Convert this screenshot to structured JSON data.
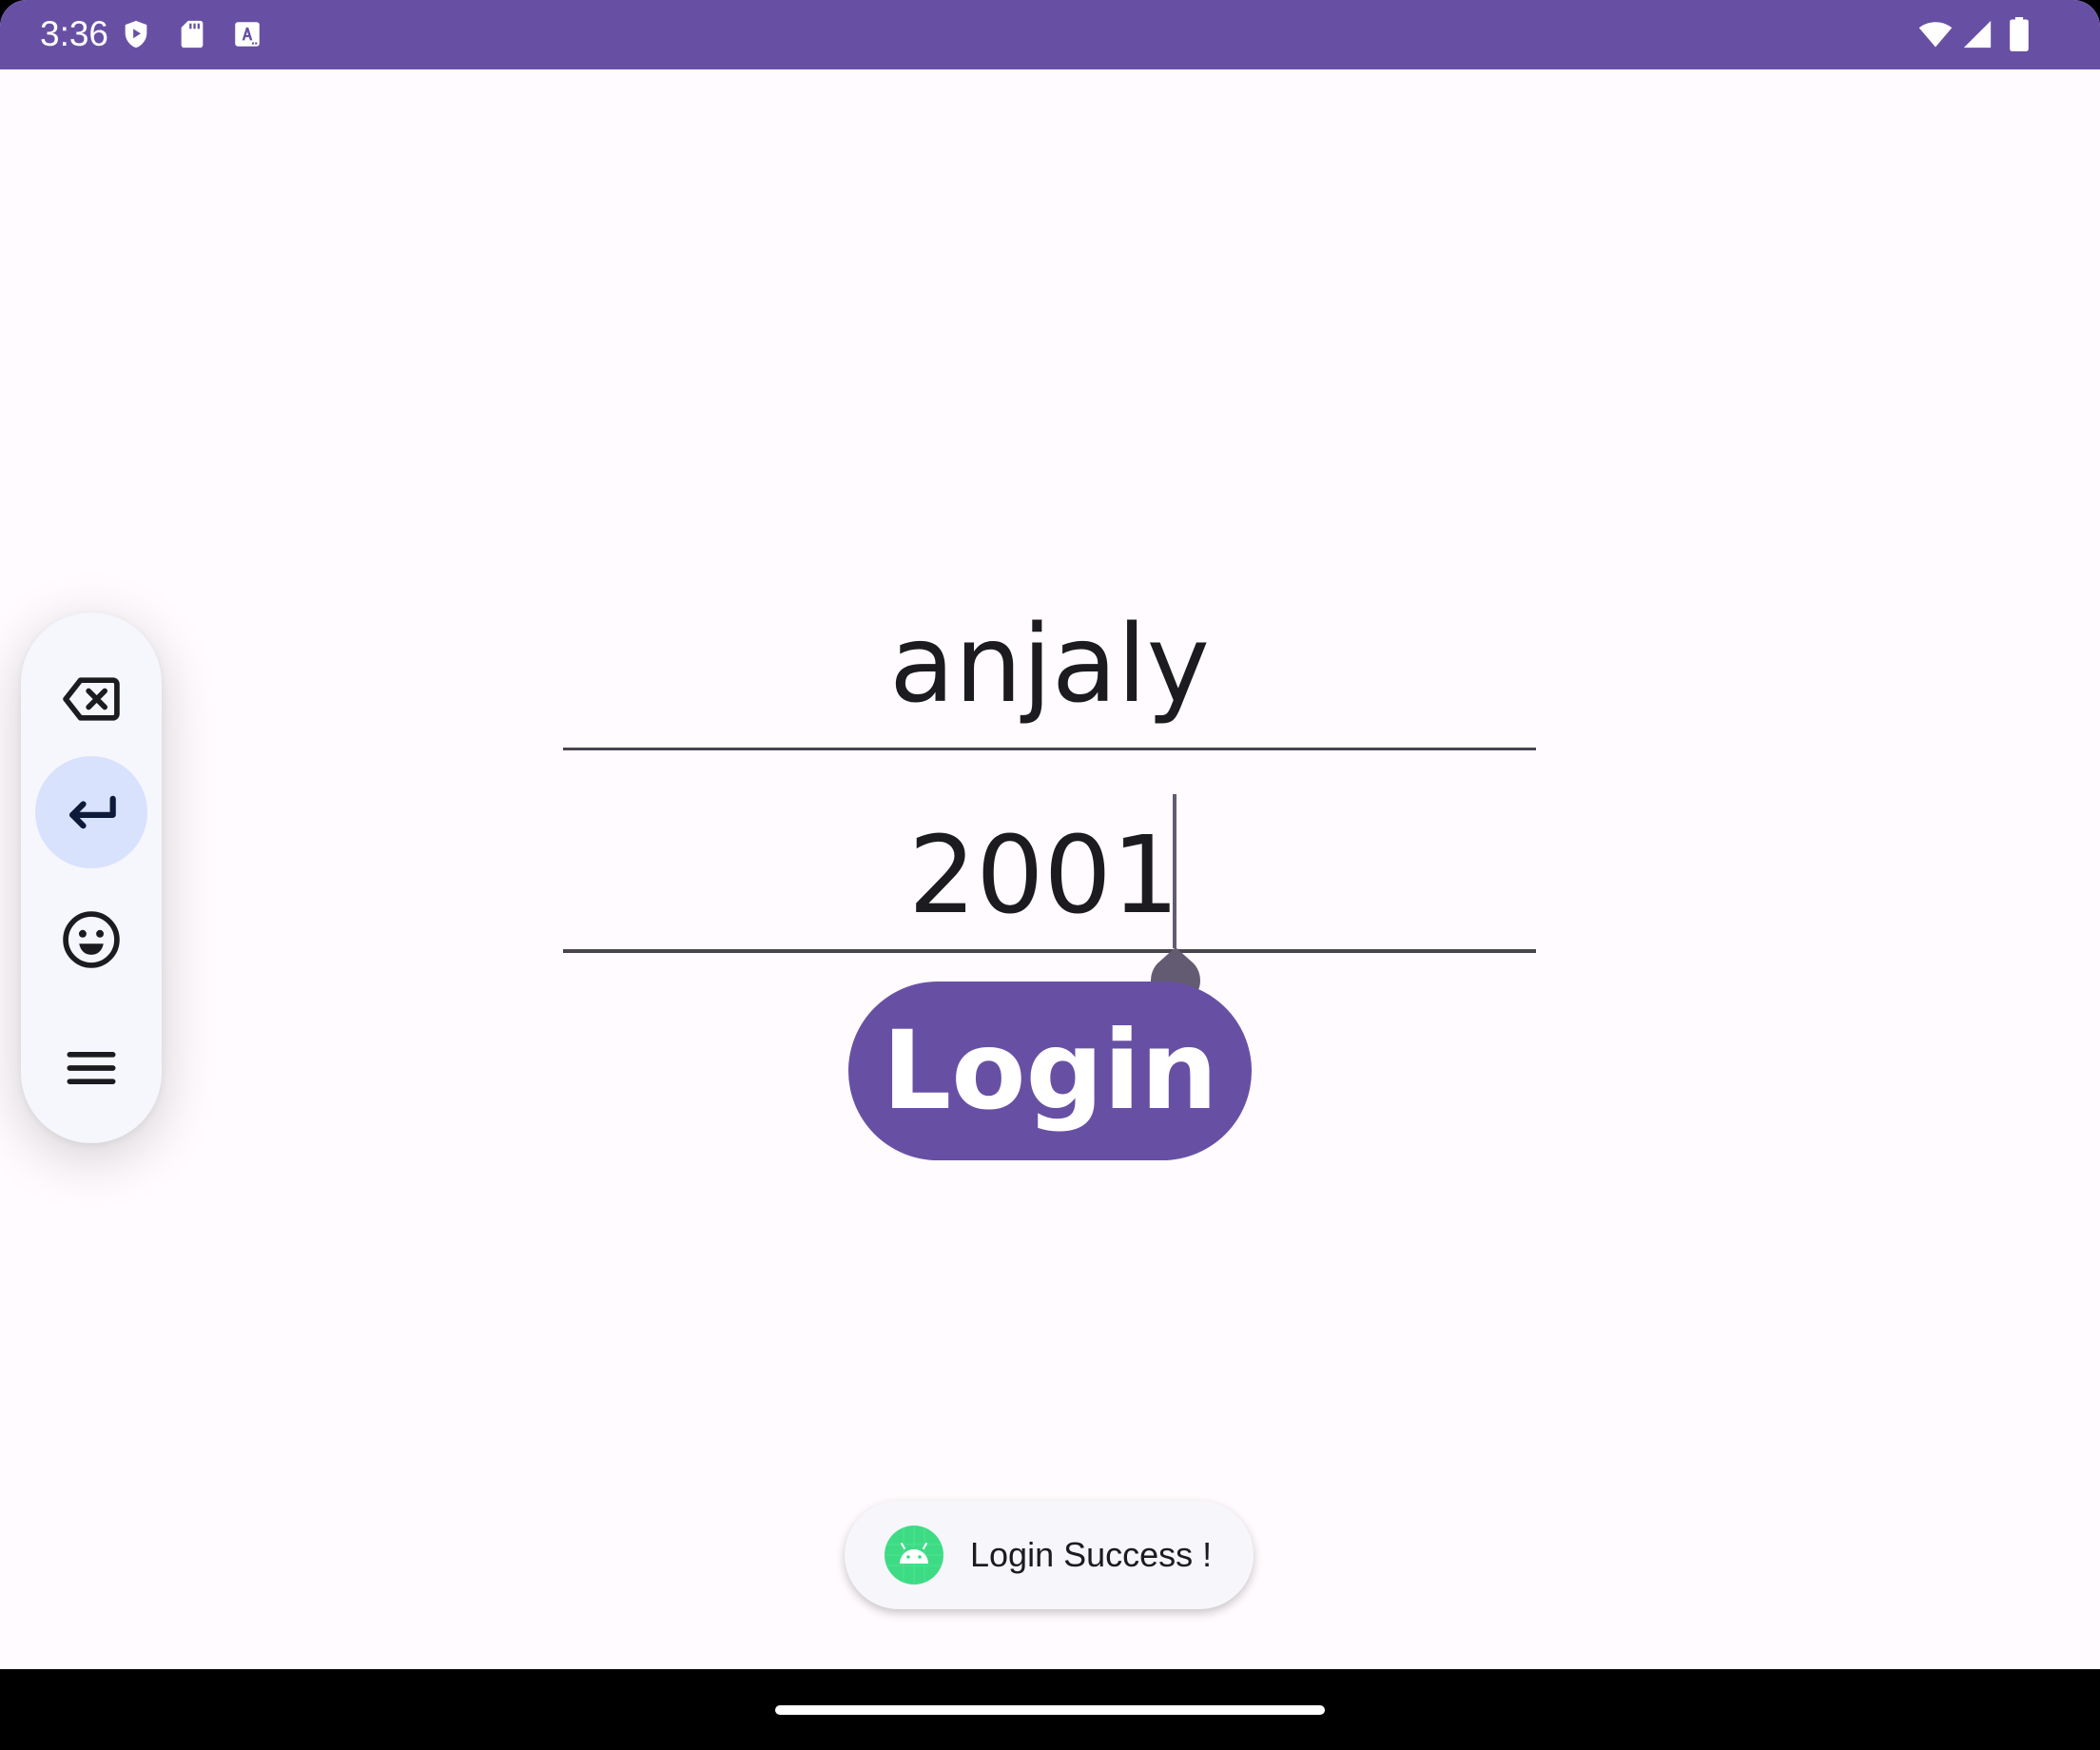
{
  "status_bar": {
    "time": "3:36",
    "left_icons": [
      "play-protect-icon",
      "sd-card-icon",
      "keyboard-a-icon"
    ],
    "right_icons": [
      "wifi-icon",
      "cellular-signal-icon",
      "battery-icon"
    ],
    "color": "#6750a4"
  },
  "login_form": {
    "username_value": "anjaly",
    "password_value": "2001",
    "login_label": "Login",
    "accent_color": "#6750a4"
  },
  "keyboard_toolbar": {
    "buttons": [
      "backspace-icon",
      "enter-icon",
      "emoji-icon",
      "menu-icon"
    ],
    "active_button": "enter-icon"
  },
  "toast": {
    "icon": "android-icon",
    "message": "Login Success !"
  },
  "nav_bar": {
    "handle": "gesture-handle"
  }
}
